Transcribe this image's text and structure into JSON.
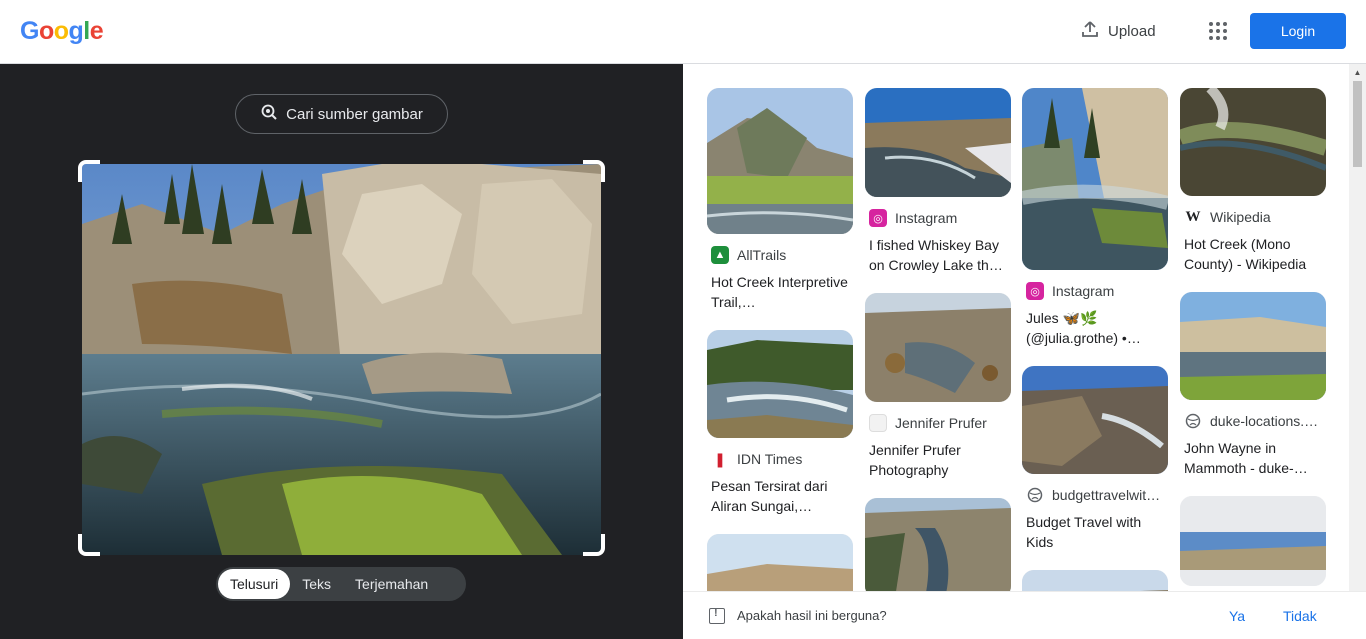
{
  "header": {
    "logo": [
      "G",
      "o",
      "o",
      "g",
      "l",
      "e"
    ],
    "upload_label": "Upload",
    "login_label": "Login"
  },
  "lens": {
    "source_button": "Cari sumber gambar",
    "tabs": [
      {
        "label": "Telusuri",
        "active": true
      },
      {
        "label": "Teks",
        "active": false
      },
      {
        "label": "Terjemahan",
        "active": false
      }
    ]
  },
  "results": {
    "col1": [
      {
        "source": "AllTrails",
        "source_icon": "alltrails-icon",
        "icon_color": "#1d8f3b",
        "title": "Hot Creek Interpretive Trail,…"
      },
      {
        "source": "IDN Times",
        "source_icon": "idntimes-icon",
        "icon_color": "#d11f2f",
        "title": "Pesan Tersirat dari Aliran Sungai,…"
      }
    ],
    "col2": [
      {
        "source": "Instagram",
        "source_icon": "instagram-icon",
        "icon_color": "#d6249f",
        "title": "I fished Whiskey Bay on Crowley Lake th…"
      },
      {
        "source": "Jennifer Prufer",
        "source_icon": "jennifer-prufer-icon",
        "icon_color": "#e8e8e8",
        "title": "Jennifer Prufer Photography"
      }
    ],
    "col3": [
      {
        "source": "Instagram",
        "source_icon": "instagram-icon",
        "icon_color": "#d6249f",
        "title": "Jules 🦋🌿 (@julia.grothe) •…"
      },
      {
        "source": "budgettravelwit…",
        "source_icon": "globe-icon",
        "icon_color": "#5f6368",
        "title": "Budget Travel with Kids"
      }
    ],
    "col4": [
      {
        "source": "Wikipedia",
        "source_icon": "wikipedia-icon",
        "icon_color": "#000000",
        "title": "Hot Creek (Mono County) - Wikipedia"
      },
      {
        "source": "duke-locations.…",
        "source_icon": "globe-icon",
        "icon_color": "#5f6368",
        "title": "John Wayne in Mammoth - duke-…"
      }
    ]
  },
  "feedback": {
    "question": "Apakah hasil ini berguna?",
    "yes": "Ya",
    "no": "Tidak"
  },
  "colors": {
    "accent": "#1a73e8",
    "panel_dark": "#202124"
  }
}
